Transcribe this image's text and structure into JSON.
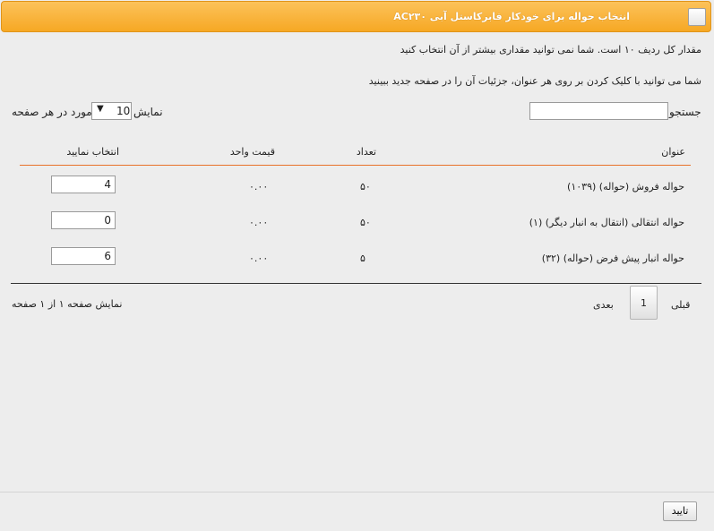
{
  "dialog": {
    "title": "انتخاب حواله برای خودکار فابرکاستل آبی AC۲۳۰"
  },
  "info": {
    "total_text": "مقدار کل ردیف ۱۰ است. شما نمی توانید مقداری بیشتر از آن انتخاب کنید",
    "hint_text": "شما می توانید با کلیک کردن بر روی هر عنوان، جزئیات آن را در صفحه جدید ببینید"
  },
  "controls": {
    "search_label": "جستجو",
    "search_value": "",
    "length_show": "نمایش",
    "length_value": "10",
    "length_rest": "مورد در هر صفحه"
  },
  "table": {
    "headers": {
      "title": "عنوان",
      "count": "تعداد",
      "price": "قیمت واحد",
      "select": "انتخاب نمایید"
    },
    "rows": [
      {
        "title": "حواله فروش (حواله) (۱۰۳۹)",
        "count": "۵۰",
        "price": "۰.۰۰",
        "qty": "4"
      },
      {
        "title": "حواله انتقالی (انتقال به انبار دیگر) (۱)",
        "count": "۵۰",
        "price": "۰.۰۰",
        "qty": "0"
      },
      {
        "title": "حواله انبار پیش فرض (حواله) (۳۲)",
        "count": "۵",
        "price": "۰.۰۰",
        "qty": "6"
      }
    ]
  },
  "pagination": {
    "info": "نمایش صفحه ۱ از ۱ صفحه",
    "prev": "قبلی",
    "current": "1",
    "next": "بعدی"
  },
  "footer": {
    "confirm_label": "تایید"
  },
  "colors": {
    "title_bar": "#f6a824",
    "header_divider": "#e8722a"
  }
}
